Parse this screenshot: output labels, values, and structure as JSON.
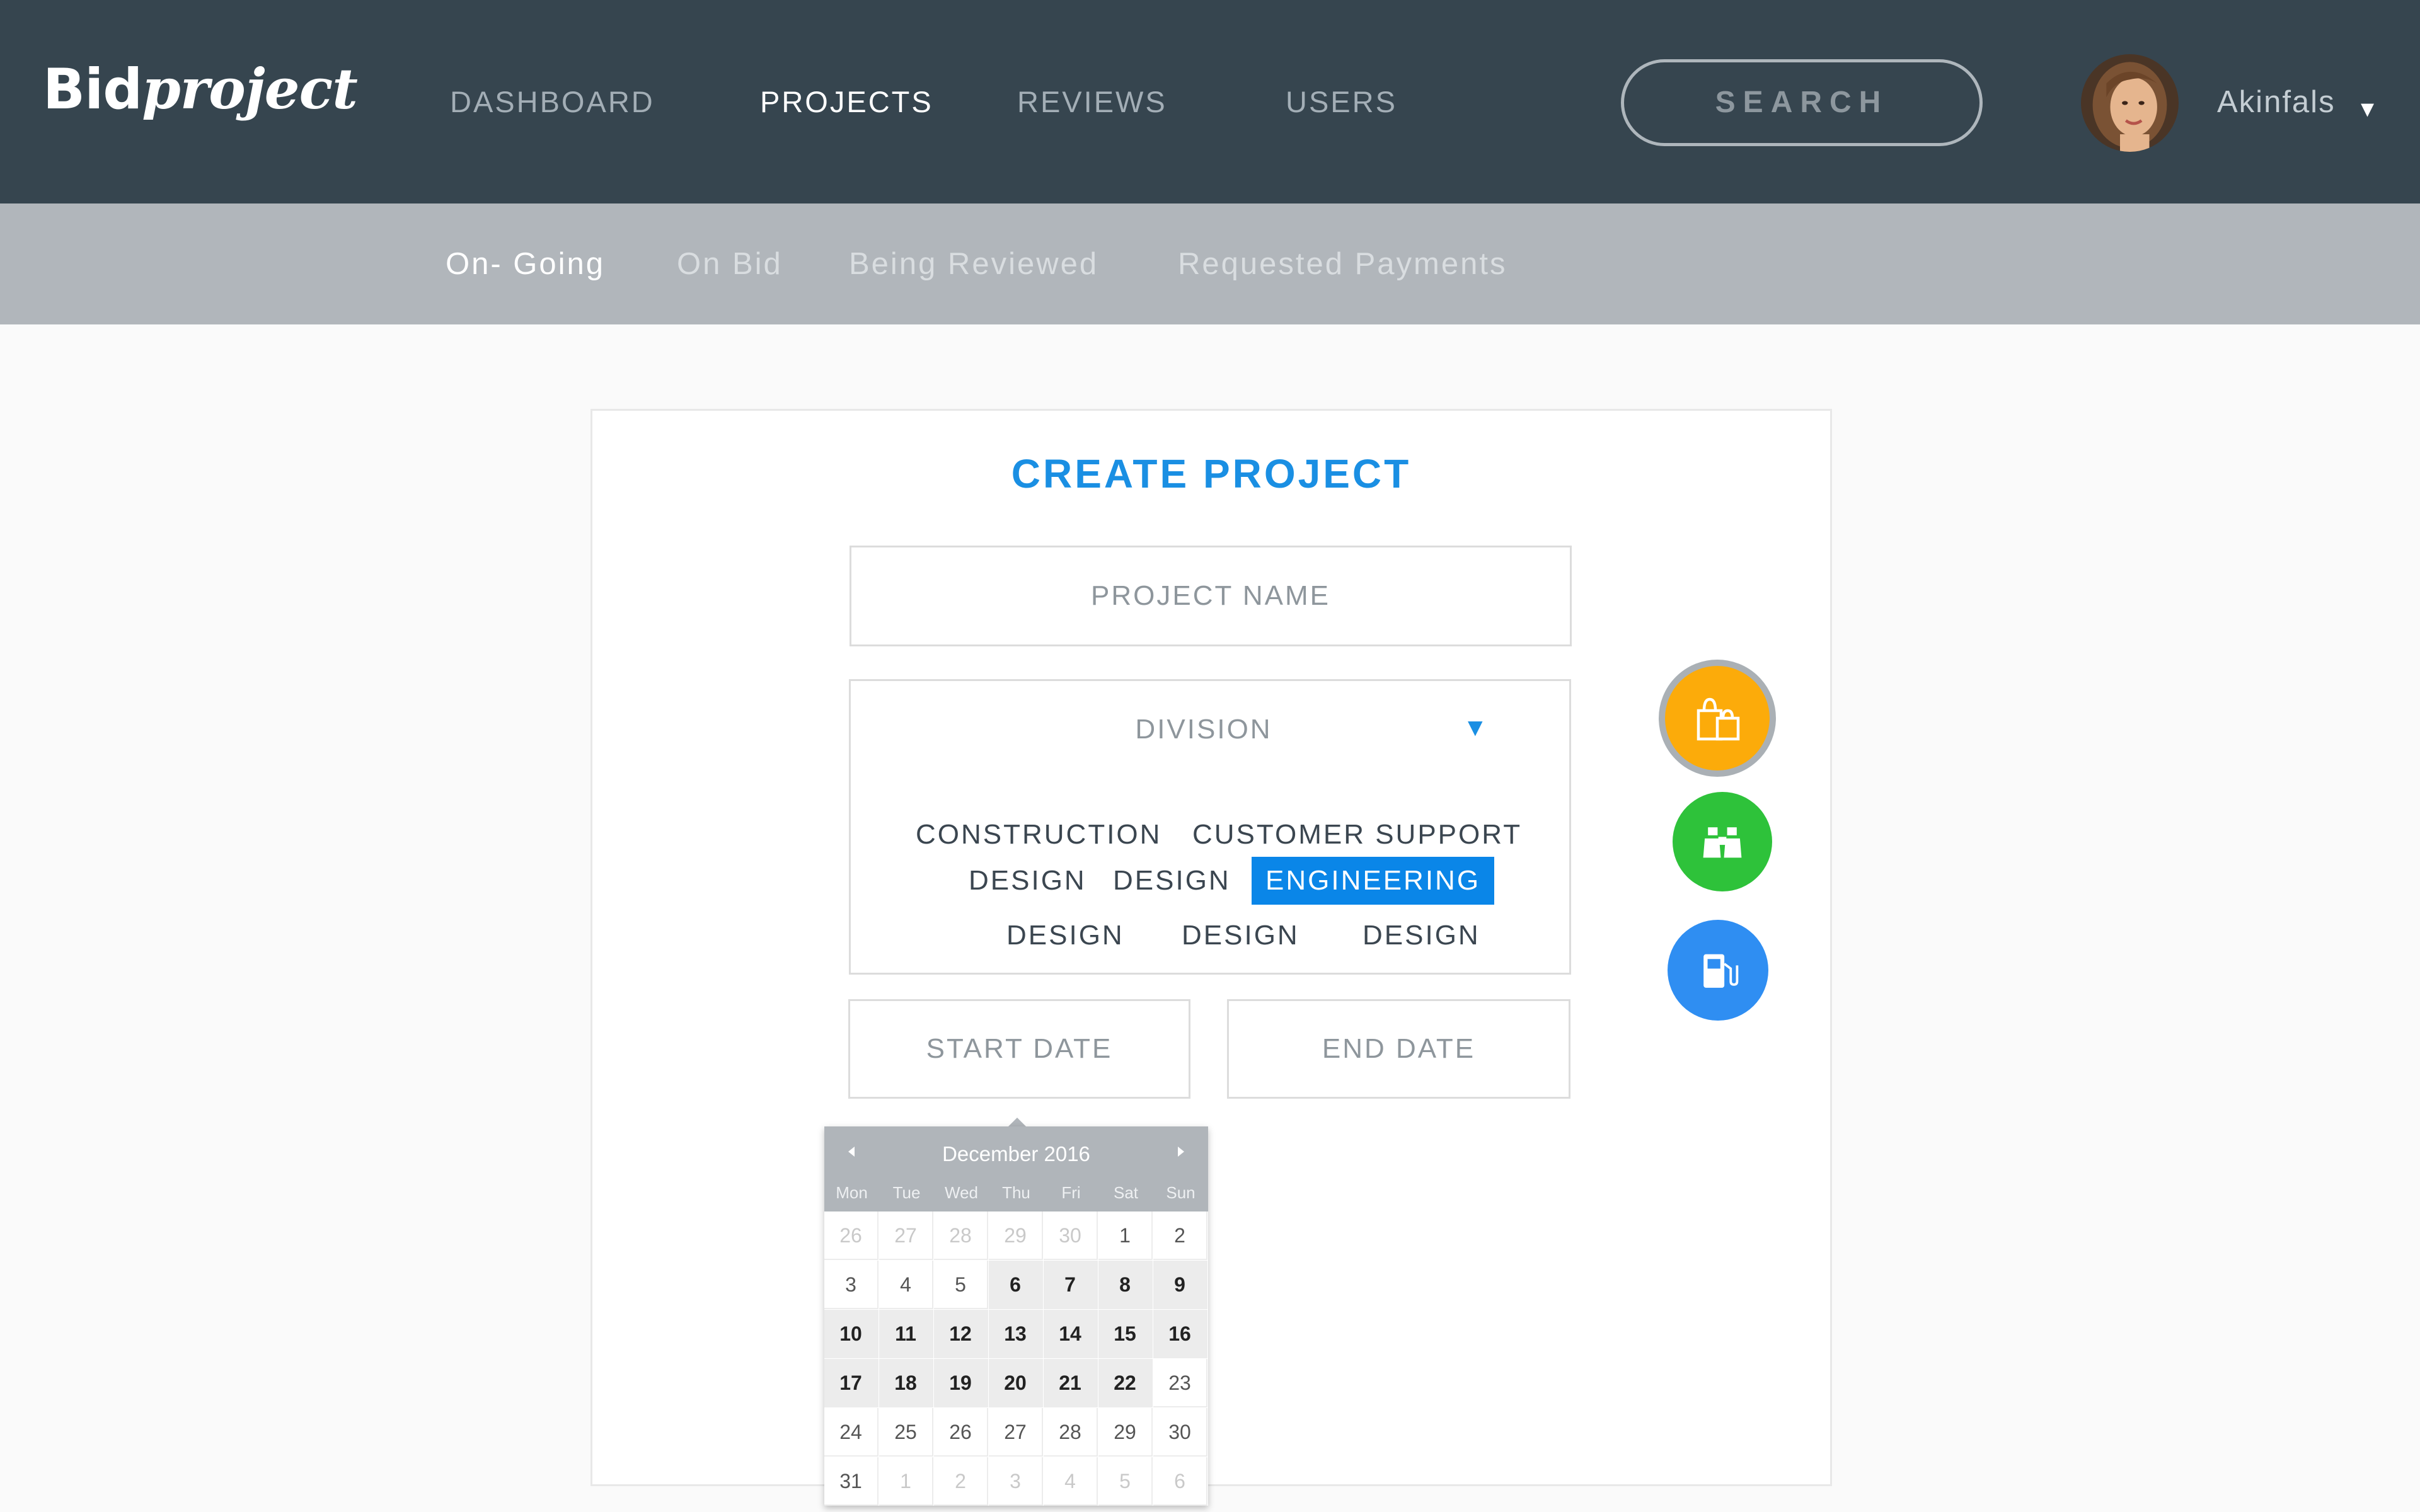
{
  "brand": {
    "logo_bold": "Bid",
    "logo_italic": "project"
  },
  "nav": {
    "items": [
      "DASHBOARD",
      "PROJECTS",
      "REVIEWS",
      "USERS"
    ],
    "active": "PROJECTS"
  },
  "search": {
    "label": "SEARCH"
  },
  "user": {
    "name": "Akinfals",
    "caret": "▾"
  },
  "subnav": {
    "items": [
      "On- Going",
      "On Bid",
      "Being Reviewed",
      "Requested Payments"
    ],
    "active": "On- Going"
  },
  "form": {
    "title": "CREATE PROJECT",
    "project_name_placeholder": "PROJECT NAME",
    "division": {
      "placeholder": "DIVISION",
      "caret": "▼",
      "options": [
        "CONSTRUCTION",
        "CUSTOMER SUPPORT",
        "DESIGN",
        "DESIGN",
        "ENGINEERING",
        "DESIGN",
        "DESIGN",
        "DESIGN"
      ],
      "selected": "ENGINEERING"
    },
    "start_date_placeholder": "START DATE",
    "end_date_placeholder": "END DATE"
  },
  "fabs": [
    {
      "icon": "shopping-bag-icon",
      "color": "#fcab0a",
      "ring": "#aab0b5"
    },
    {
      "icon": "binoculars-icon",
      "color": "#2ec23a"
    },
    {
      "icon": "fuel-pump-icon",
      "color": "#2f8ef2"
    }
  ],
  "datepicker": {
    "month_label": "December 2016",
    "weekdays": [
      "Mon",
      "Tue",
      "Wed",
      "Thu",
      "Fri",
      "Sat",
      "Sun"
    ],
    "weeks": [
      [
        "26",
        "27",
        "28",
        "29",
        "30",
        "1",
        "2"
      ],
      [
        "3",
        "4",
        "5",
        "6",
        "7",
        "8",
        "9"
      ],
      [
        "10",
        "11",
        "12",
        "13",
        "14",
        "15",
        "16"
      ],
      [
        "17",
        "18",
        "19",
        "20",
        "21",
        "22",
        "23"
      ],
      [
        "24",
        "25",
        "26",
        "27",
        "28",
        "29",
        "30"
      ],
      [
        "31",
        "1",
        "2",
        "3",
        "4",
        "5",
        "6"
      ]
    ],
    "highlighted_range": {
      "start": "2016-12-06",
      "end": "2016-12-22"
    },
    "colors": {
      "header": "#b0b5ba",
      "range": "#ececec"
    }
  },
  "colors": {
    "topbar": "#36454f",
    "subbar": "#b1b6bb",
    "accent": "#1a8fe3",
    "selected_option": "#0a86e8"
  }
}
